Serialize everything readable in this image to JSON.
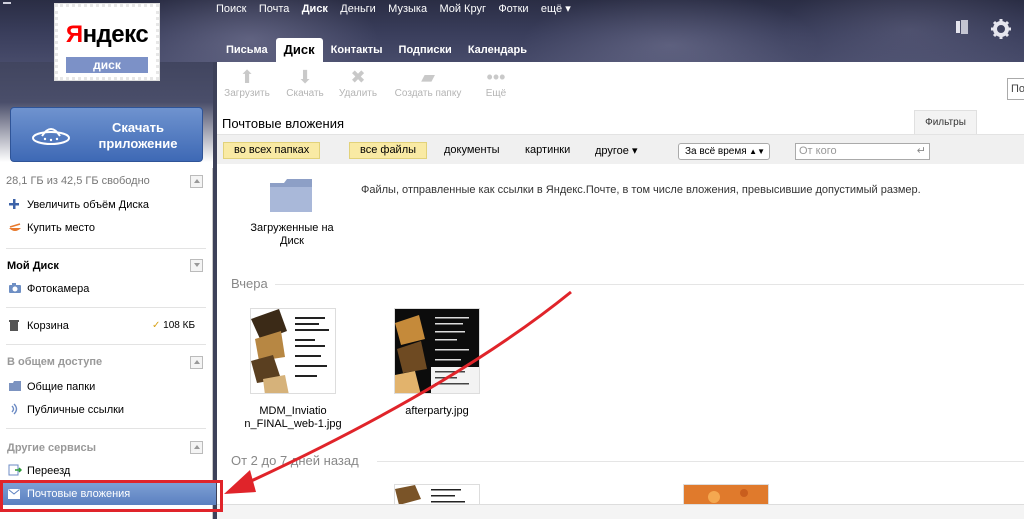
{
  "header": {
    "services": [
      "Поиск",
      "Почта",
      "Диск",
      "Деньги",
      "Музыка",
      "Мой Круг",
      "Фотки",
      "ещё ▾"
    ],
    "active_service": "Диск",
    "mail_tabs": [
      "Письма",
      "Диск",
      "Контакты",
      "Подписки",
      "Календарь"
    ],
    "selected_tab": "Диск",
    "logo": {
      "brand_first": "Я",
      "brand_rest": "ндекс",
      "service": "диск"
    },
    "right_icons": [
      "wallet-icon",
      "gear-icon"
    ]
  },
  "sidebar": {
    "download_button": {
      "line1": "Скачать",
      "line2": "приложение"
    },
    "free_space": "28,1 ГБ из 42,5 ГБ свободно",
    "increase_space": "Увеличить объём Диска",
    "buy_space": "Купить место",
    "my_disk_title": "Мой Диск",
    "camera": "Фотокамера",
    "trash": "Корзина",
    "trash_size": "108 КБ",
    "shared_title": "В общем доступе",
    "shared_folders": "Общие папки",
    "public_links": "Публичные ссылки",
    "other_title": "Другие сервисы",
    "move": "Переезд",
    "mail_attachments": "Почтовые вложения"
  },
  "toolbar": {
    "upload": "Загрузить",
    "download": "Скачать",
    "delete": "Удалить",
    "create_folder": "Создать папку",
    "more": "Ещё",
    "search_partial": "По"
  },
  "main": {
    "title": "Почтовые вложения",
    "filters_tab": "Фильтры",
    "chip_all_folders": "во всех папках",
    "chip_all_files": "все файлы",
    "filter_documents": "документы",
    "filter_pictures": "картинки",
    "filter_other": "другое ▾",
    "time_select": "За всё время",
    "from_placeholder": "От кого",
    "folder_caption_1": "Загруженные на",
    "folder_caption_2": "Диск",
    "info": "Файлы, отправленные как ссылки в Яндекс.Почте, в том числе вложения, превысившие допустимый размер.",
    "group_yesterday": "Вчера",
    "group_older": "От 2 до 7 дней назад",
    "file1_line1": "MDM_Inviatio",
    "file1_line2": "n_FINAL_web-1.jpg",
    "file2": "afterparty.jpg"
  },
  "colors": {
    "header_bg": "#3a3e5c",
    "accent_blue": "#3e69b5",
    "selected_item": "#5b80c0",
    "chip_yellow": "#f9eaa4",
    "annotation_red": "#e0242a"
  }
}
